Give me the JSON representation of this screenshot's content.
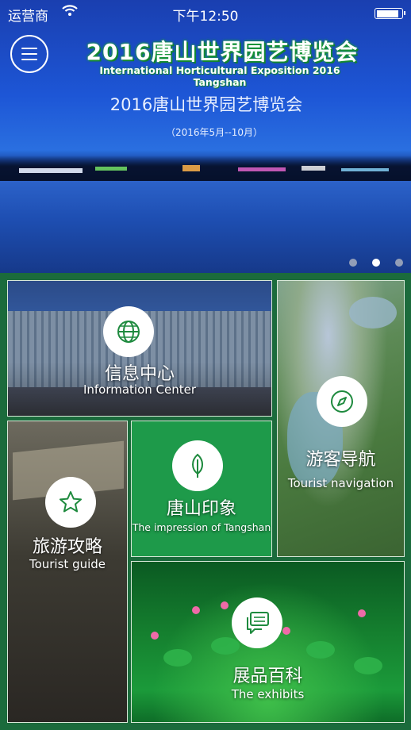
{
  "status_bar": {
    "carrier": "运营商",
    "time": "下午12:50",
    "battery_level": 0.9
  },
  "banner": {
    "title_cn": "2016唐山世界园艺博览会",
    "title_en": "International Horticultural Exposition 2016 Tangshan",
    "subtitle_cn": "2016唐山世界园艺博览会",
    "dates": "（2016年5月--10月）",
    "carousel": {
      "count": 3,
      "active_index": 1
    }
  },
  "tiles": [
    {
      "id": "info",
      "cn": "信息中心",
      "en": "Information Center",
      "icon": "globe-icon"
    },
    {
      "id": "nav",
      "cn": "游客导航",
      "en": "Tourist navigation",
      "icon": "compass-icon"
    },
    {
      "id": "guide",
      "cn": "旅游攻略",
      "en": "Tourist guide",
      "icon": "star-icon"
    },
    {
      "id": "impression",
      "cn": "唐山印象",
      "en": "The impression of Tangshan",
      "icon": "leaf-icon"
    },
    {
      "id": "exhibits",
      "cn": "展品百科",
      "en": "The exhibits",
      "icon": "chat-icon"
    }
  ],
  "colors": {
    "background": "#1b6b3c",
    "icon_green": "#1e8a3e",
    "impression_tile": "#1e9a4a"
  }
}
